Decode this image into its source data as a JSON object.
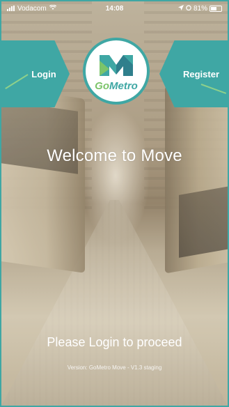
{
  "status_bar": {
    "carrier": "Vodacom",
    "time": "14:08",
    "battery": "81%"
  },
  "login": {
    "label": "Login"
  },
  "register": {
    "label": "Register"
  },
  "logo": {
    "go": "Go",
    "metro": "Metro"
  },
  "welcome_text": "Welcome to Move",
  "prompt_text": "Please Login to proceed",
  "version_text": "Version: GoMetro Move - V1.3 staging",
  "colors": {
    "accent": "#3fa7a4",
    "green": "#7cc46a"
  },
  "icons": [
    "signal-icon",
    "wifi-icon",
    "location-icon",
    "alarm-icon",
    "battery-icon",
    "gometro-logo-icon"
  ]
}
